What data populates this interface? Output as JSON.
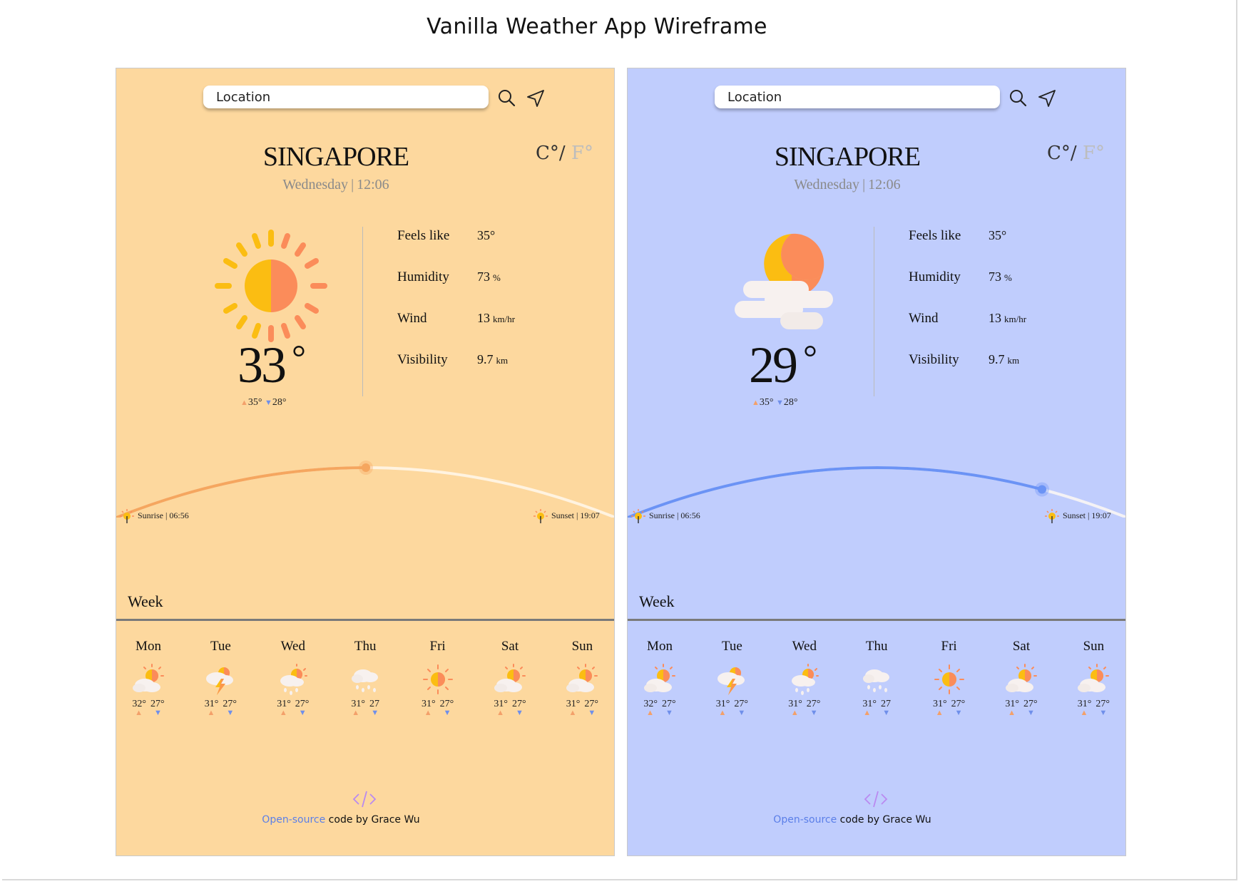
{
  "page_title": "Vanilla Weather App Wireframe",
  "panels": [
    {
      "theme": "day",
      "background": "#fdd89e",
      "search": {
        "placeholder": "Location"
      },
      "icons": {
        "search": "search-icon",
        "locate": "location-arrow-icon",
        "weather": "sun-icon"
      },
      "units": {
        "celsius": "C°",
        "separator": "/",
        "fahrenheit": "F°"
      },
      "city": "SINGAPORE",
      "day": "Wednesday",
      "separator": "|",
      "time": "12:06",
      "temperature": "33",
      "degree": "°",
      "high": "35°",
      "low": "28°",
      "details": [
        {
          "label": "Feels like",
          "value": "35°",
          "unit": ""
        },
        {
          "label": "Humidity",
          "value": "73",
          "unit": "%"
        },
        {
          "label": "Wind",
          "value": "13",
          "unit": "km/hr"
        },
        {
          "label": "Visibility",
          "value": "9.7",
          "unit": "km"
        }
      ],
      "sun_progress_colour": "#f5a65f",
      "sun_position": 0.5,
      "sunrise_text": "Sunrise | 06:56",
      "sunset_text": "Sunset | 19:07",
      "week_title": "Week",
      "forecast": [
        {
          "day": "Mon",
          "icon": "partly-cloudy-icon",
          "high": "32°",
          "low": "27°"
        },
        {
          "day": "Tue",
          "icon": "thunder-icon",
          "high": "31°",
          "low": "27°"
        },
        {
          "day": "Wed",
          "icon": "rain-sun-icon",
          "high": "31°",
          "low": "27°"
        },
        {
          "day": "Thu",
          "icon": "rain-cloud-icon",
          "high": "31°",
          "low": "27"
        },
        {
          "day": "Fri",
          "icon": "sun-icon",
          "high": "31°",
          "low": "27°"
        },
        {
          "day": "Sat",
          "icon": "partly-cloudy-icon",
          "high": "31°",
          "low": "27°"
        },
        {
          "day": "Sun",
          "icon": "partly-cloudy-icon",
          "high": "31°",
          "low": "27°"
        }
      ],
      "credit_link": "Open-source",
      "credit_text": " code by Grace Wu"
    },
    {
      "theme": "night",
      "background": "#c0cdfd",
      "search": {
        "placeholder": "Location"
      },
      "icons": {
        "search": "search-icon",
        "locate": "location-arrow-icon",
        "weather": "moon-cloud-icon"
      },
      "units": {
        "celsius": "C°",
        "separator": "/",
        "fahrenheit": "F°"
      },
      "city": "SINGAPORE",
      "day": "Wednesday",
      "separator": "|",
      "time": "12:06",
      "temperature": "29",
      "degree": "°",
      "high": "35°",
      "low": "28°",
      "details": [
        {
          "label": "Feels like",
          "value": "35°",
          "unit": ""
        },
        {
          "label": "Humidity",
          "value": "73",
          "unit": "%"
        },
        {
          "label": "Wind",
          "value": "13",
          "unit": "km/hr"
        },
        {
          "label": "Visibility",
          "value": "9.7",
          "unit": "km"
        }
      ],
      "sun_progress_colour": "#6b93f5",
      "sun_position": 0.83,
      "sunrise_text": "Sunrise | 06:56",
      "sunset_text": "Sunset | 19:07",
      "week_title": "Week",
      "forecast": [
        {
          "day": "Mon",
          "icon": "partly-cloudy-icon",
          "high": "32°",
          "low": "27°"
        },
        {
          "day": "Tue",
          "icon": "thunder-icon",
          "high": "31°",
          "low": "27°"
        },
        {
          "day": "Wed",
          "icon": "rain-sun-icon",
          "high": "31°",
          "low": "27°"
        },
        {
          "day": "Thu",
          "icon": "rain-cloud-icon",
          "high": "31°",
          "low": "27"
        },
        {
          "day": "Fri",
          "icon": "sun-icon",
          "high": "31°",
          "low": "27°"
        },
        {
          "day": "Sat",
          "icon": "partly-cloudy-icon",
          "high": "31°",
          "low": "27°"
        },
        {
          "day": "Sun",
          "icon": "partly-cloudy-icon",
          "high": "31°",
          "low": "27°"
        }
      ],
      "credit_link": "Open-source",
      "credit_text": " code by Grace Wu"
    }
  ]
}
